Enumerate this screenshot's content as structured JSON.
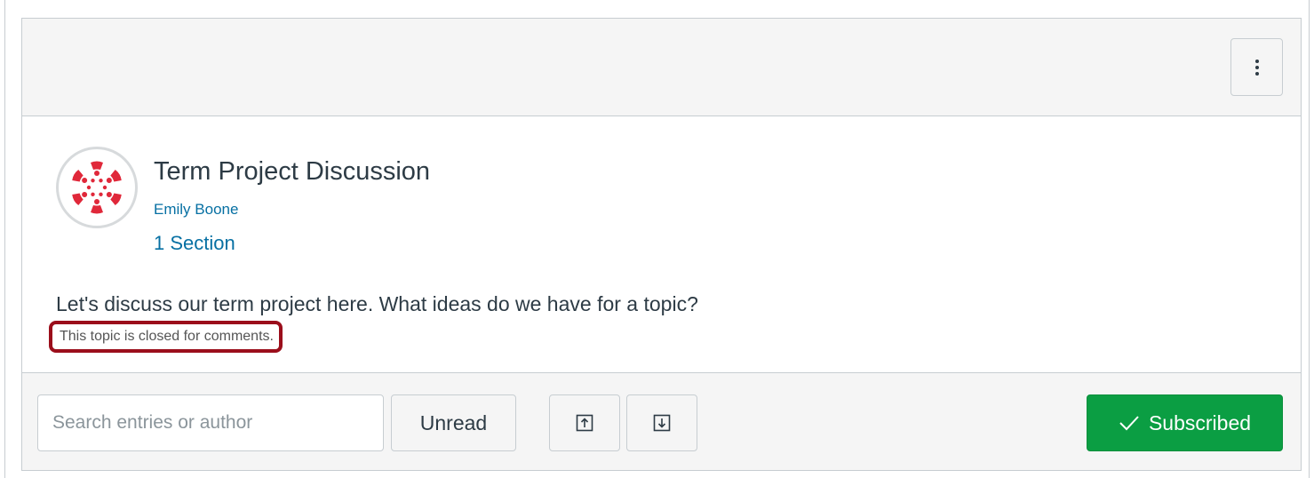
{
  "header": {
    "options_icon": "kebab-vertical-icon"
  },
  "topic": {
    "title": "Term Project Discussion",
    "author": "Emily Boone",
    "sections": "1 Section",
    "message": "Let's discuss our term project here. What ideas do we have for a topic?",
    "closed_note": "This topic is closed for comments.",
    "avatar_icon": "canvas-logo-icon"
  },
  "toolbar": {
    "search_placeholder": "Search entries or author",
    "unread_label": "Unread",
    "collapse_icon": "collapse-all-icon",
    "expand_icon": "expand-all-icon",
    "subscribed_label": "Subscribed",
    "subscribed_icon": "checkmark-icon"
  },
  "colors": {
    "link": "#0770a3",
    "subscribed_bg": "#0b9e43",
    "highlight_border": "#9b0e1b",
    "logo_red": "#e0283a"
  }
}
